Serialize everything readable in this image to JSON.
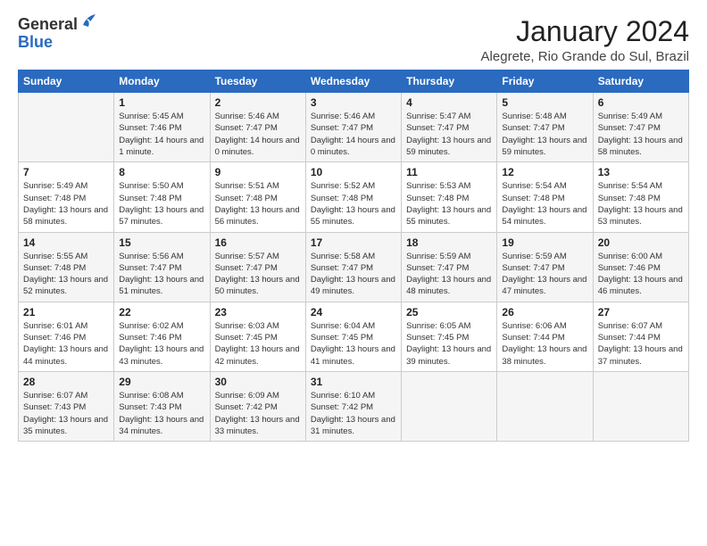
{
  "header": {
    "logo_general": "General",
    "logo_blue": "Blue",
    "month_year": "January 2024",
    "location": "Alegrete, Rio Grande do Sul, Brazil"
  },
  "days_of_week": [
    "Sunday",
    "Monday",
    "Tuesday",
    "Wednesday",
    "Thursday",
    "Friday",
    "Saturday"
  ],
  "weeks": [
    [
      {
        "day": "",
        "sunrise": "",
        "sunset": "",
        "daylight": ""
      },
      {
        "day": "1",
        "sunrise": "Sunrise: 5:45 AM",
        "sunset": "Sunset: 7:46 PM",
        "daylight": "Daylight: 14 hours and 1 minute."
      },
      {
        "day": "2",
        "sunrise": "Sunrise: 5:46 AM",
        "sunset": "Sunset: 7:47 PM",
        "daylight": "Daylight: 14 hours and 0 minutes."
      },
      {
        "day": "3",
        "sunrise": "Sunrise: 5:46 AM",
        "sunset": "Sunset: 7:47 PM",
        "daylight": "Daylight: 14 hours and 0 minutes."
      },
      {
        "day": "4",
        "sunrise": "Sunrise: 5:47 AM",
        "sunset": "Sunset: 7:47 PM",
        "daylight": "Daylight: 13 hours and 59 minutes."
      },
      {
        "day": "5",
        "sunrise": "Sunrise: 5:48 AM",
        "sunset": "Sunset: 7:47 PM",
        "daylight": "Daylight: 13 hours and 59 minutes."
      },
      {
        "day": "6",
        "sunrise": "Sunrise: 5:49 AM",
        "sunset": "Sunset: 7:47 PM",
        "daylight": "Daylight: 13 hours and 58 minutes."
      }
    ],
    [
      {
        "day": "7",
        "sunrise": "Sunrise: 5:49 AM",
        "sunset": "Sunset: 7:48 PM",
        "daylight": "Daylight: 13 hours and 58 minutes."
      },
      {
        "day": "8",
        "sunrise": "Sunrise: 5:50 AM",
        "sunset": "Sunset: 7:48 PM",
        "daylight": "Daylight: 13 hours and 57 minutes."
      },
      {
        "day": "9",
        "sunrise": "Sunrise: 5:51 AM",
        "sunset": "Sunset: 7:48 PM",
        "daylight": "Daylight: 13 hours and 56 minutes."
      },
      {
        "day": "10",
        "sunrise": "Sunrise: 5:52 AM",
        "sunset": "Sunset: 7:48 PM",
        "daylight": "Daylight: 13 hours and 55 minutes."
      },
      {
        "day": "11",
        "sunrise": "Sunrise: 5:53 AM",
        "sunset": "Sunset: 7:48 PM",
        "daylight": "Daylight: 13 hours and 55 minutes."
      },
      {
        "day": "12",
        "sunrise": "Sunrise: 5:54 AM",
        "sunset": "Sunset: 7:48 PM",
        "daylight": "Daylight: 13 hours and 54 minutes."
      },
      {
        "day": "13",
        "sunrise": "Sunrise: 5:54 AM",
        "sunset": "Sunset: 7:48 PM",
        "daylight": "Daylight: 13 hours and 53 minutes."
      }
    ],
    [
      {
        "day": "14",
        "sunrise": "Sunrise: 5:55 AM",
        "sunset": "Sunset: 7:48 PM",
        "daylight": "Daylight: 13 hours and 52 minutes."
      },
      {
        "day": "15",
        "sunrise": "Sunrise: 5:56 AM",
        "sunset": "Sunset: 7:47 PM",
        "daylight": "Daylight: 13 hours and 51 minutes."
      },
      {
        "day": "16",
        "sunrise": "Sunrise: 5:57 AM",
        "sunset": "Sunset: 7:47 PM",
        "daylight": "Daylight: 13 hours and 50 minutes."
      },
      {
        "day": "17",
        "sunrise": "Sunrise: 5:58 AM",
        "sunset": "Sunset: 7:47 PM",
        "daylight": "Daylight: 13 hours and 49 minutes."
      },
      {
        "day": "18",
        "sunrise": "Sunrise: 5:59 AM",
        "sunset": "Sunset: 7:47 PM",
        "daylight": "Daylight: 13 hours and 48 minutes."
      },
      {
        "day": "19",
        "sunrise": "Sunrise: 5:59 AM",
        "sunset": "Sunset: 7:47 PM",
        "daylight": "Daylight: 13 hours and 47 minutes."
      },
      {
        "day": "20",
        "sunrise": "Sunrise: 6:00 AM",
        "sunset": "Sunset: 7:46 PM",
        "daylight": "Daylight: 13 hours and 46 minutes."
      }
    ],
    [
      {
        "day": "21",
        "sunrise": "Sunrise: 6:01 AM",
        "sunset": "Sunset: 7:46 PM",
        "daylight": "Daylight: 13 hours and 44 minutes."
      },
      {
        "day": "22",
        "sunrise": "Sunrise: 6:02 AM",
        "sunset": "Sunset: 7:46 PM",
        "daylight": "Daylight: 13 hours and 43 minutes."
      },
      {
        "day": "23",
        "sunrise": "Sunrise: 6:03 AM",
        "sunset": "Sunset: 7:45 PM",
        "daylight": "Daylight: 13 hours and 42 minutes."
      },
      {
        "day": "24",
        "sunrise": "Sunrise: 6:04 AM",
        "sunset": "Sunset: 7:45 PM",
        "daylight": "Daylight: 13 hours and 41 minutes."
      },
      {
        "day": "25",
        "sunrise": "Sunrise: 6:05 AM",
        "sunset": "Sunset: 7:45 PM",
        "daylight": "Daylight: 13 hours and 39 minutes."
      },
      {
        "day": "26",
        "sunrise": "Sunrise: 6:06 AM",
        "sunset": "Sunset: 7:44 PM",
        "daylight": "Daylight: 13 hours and 38 minutes."
      },
      {
        "day": "27",
        "sunrise": "Sunrise: 6:07 AM",
        "sunset": "Sunset: 7:44 PM",
        "daylight": "Daylight: 13 hours and 37 minutes."
      }
    ],
    [
      {
        "day": "28",
        "sunrise": "Sunrise: 6:07 AM",
        "sunset": "Sunset: 7:43 PM",
        "daylight": "Daylight: 13 hours and 35 minutes."
      },
      {
        "day": "29",
        "sunrise": "Sunrise: 6:08 AM",
        "sunset": "Sunset: 7:43 PM",
        "daylight": "Daylight: 13 hours and 34 minutes."
      },
      {
        "day": "30",
        "sunrise": "Sunrise: 6:09 AM",
        "sunset": "Sunset: 7:42 PM",
        "daylight": "Daylight: 13 hours and 33 minutes."
      },
      {
        "day": "31",
        "sunrise": "Sunrise: 6:10 AM",
        "sunset": "Sunset: 7:42 PM",
        "daylight": "Daylight: 13 hours and 31 minutes."
      },
      {
        "day": "",
        "sunrise": "",
        "sunset": "",
        "daylight": ""
      },
      {
        "day": "",
        "sunrise": "",
        "sunset": "",
        "daylight": ""
      },
      {
        "day": "",
        "sunrise": "",
        "sunset": "",
        "daylight": ""
      }
    ]
  ]
}
